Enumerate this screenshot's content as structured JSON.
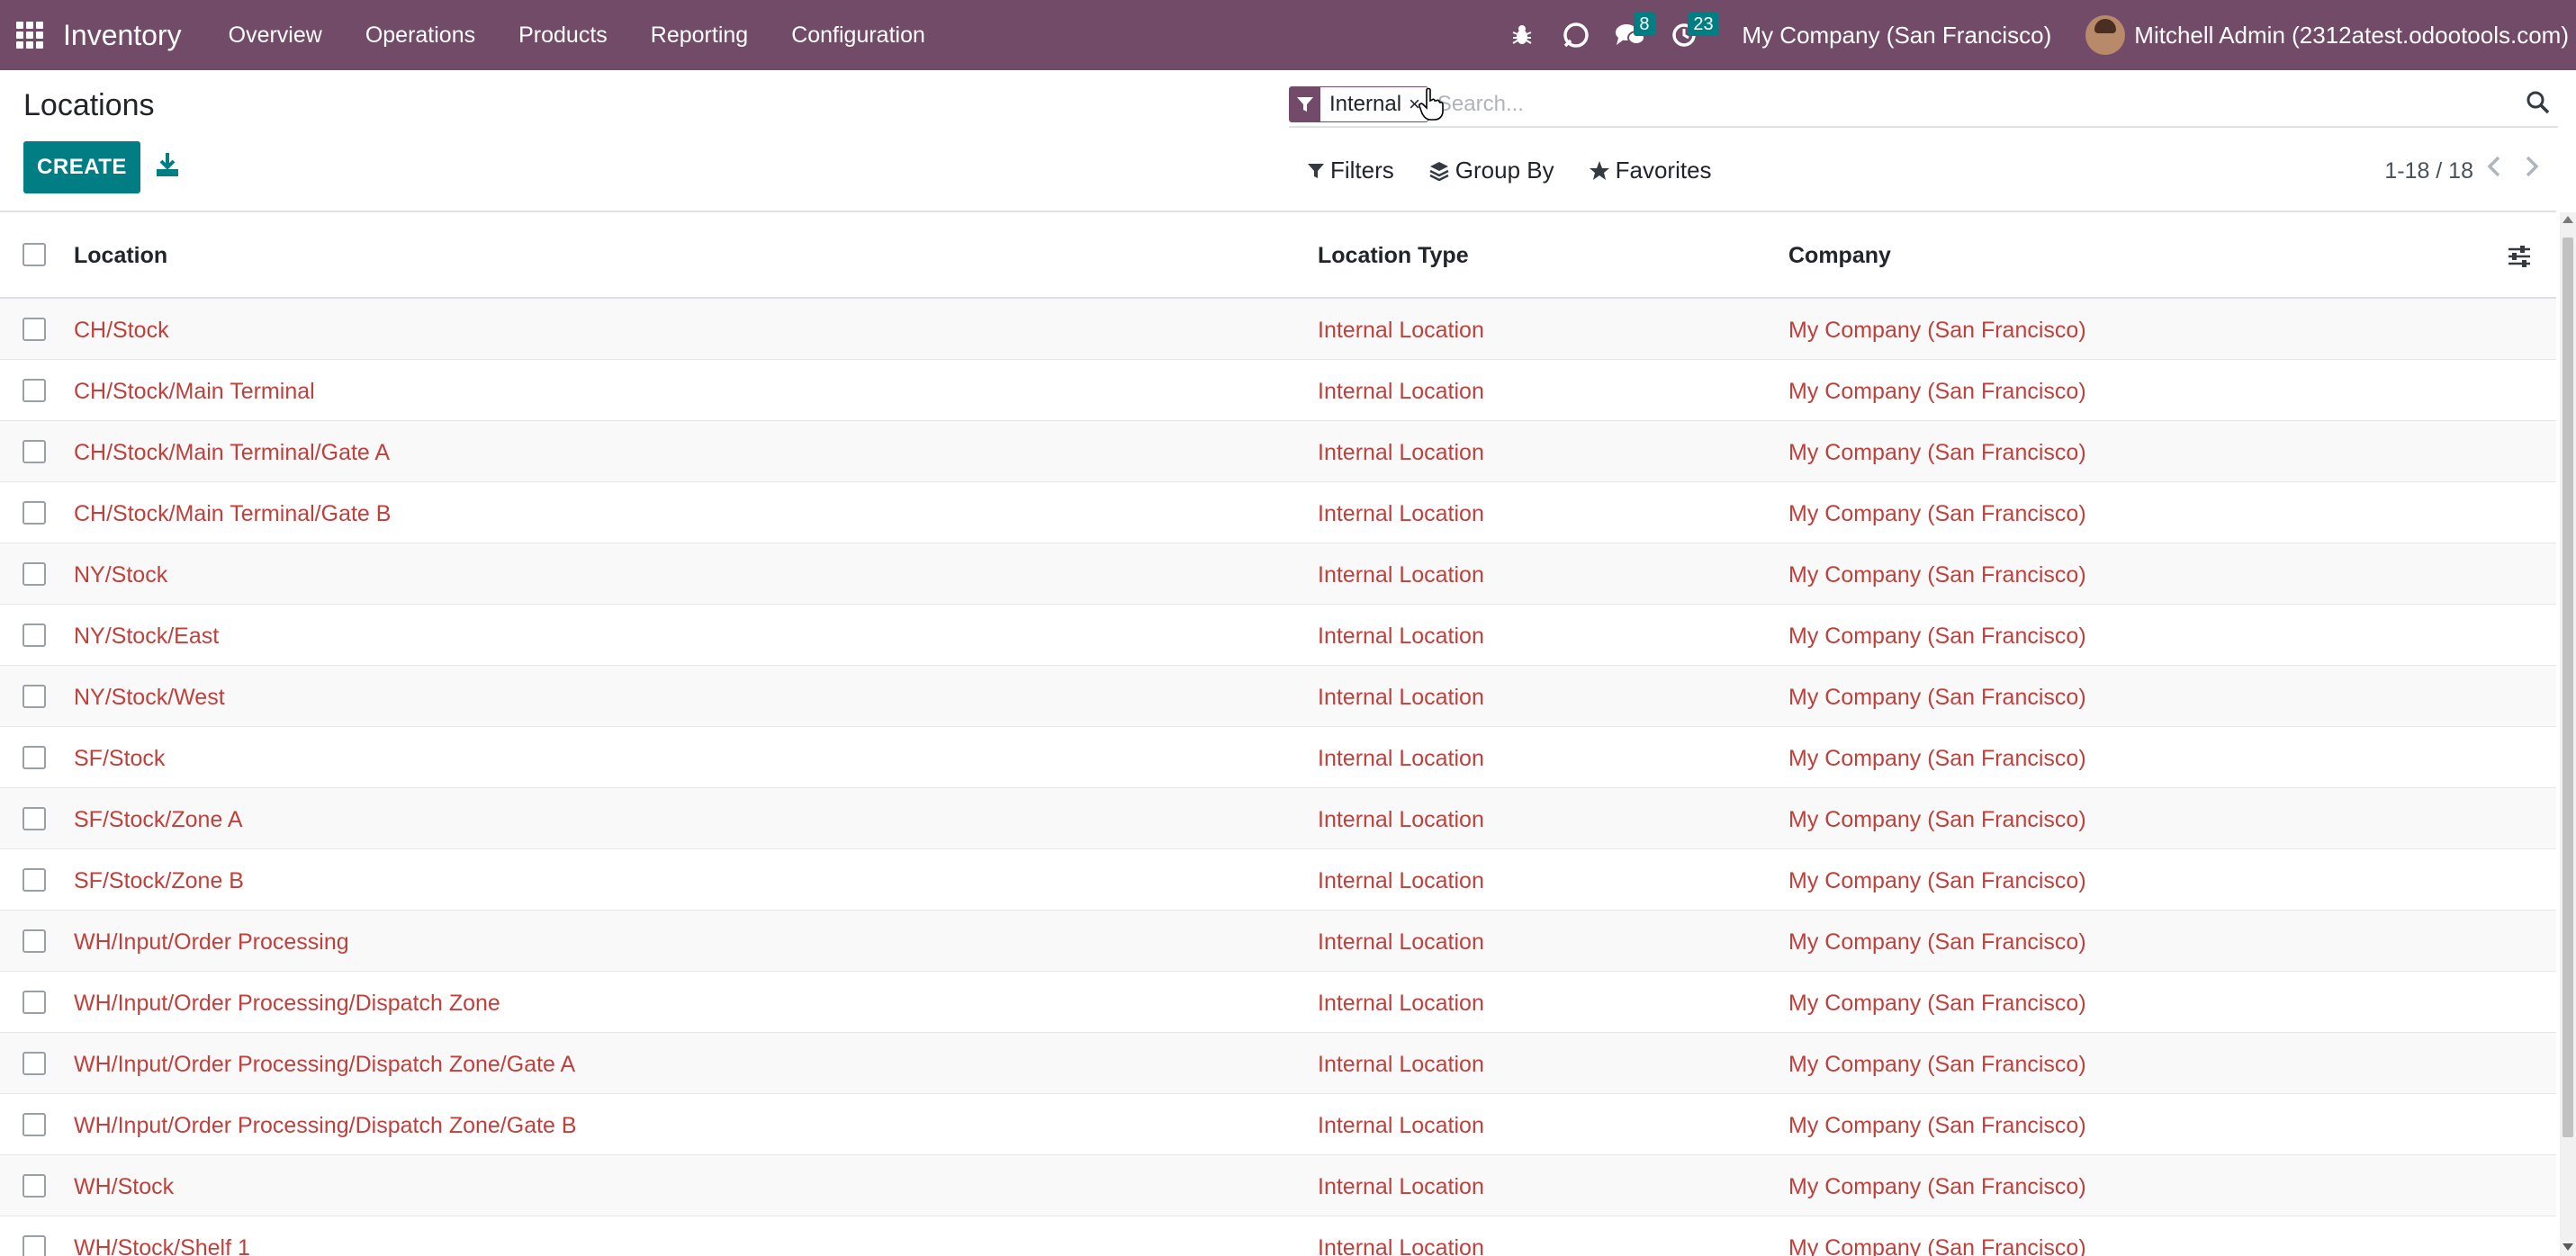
{
  "navbar": {
    "app_name": "Inventory",
    "menu": [
      "Overview",
      "Operations",
      "Products",
      "Reporting",
      "Configuration"
    ],
    "messages_count": "8",
    "activities_count": "23",
    "company": "My Company (San Francisco)",
    "user": "Mitchell Admin (2312atest.odootools.com)"
  },
  "control_panel": {
    "breadcrumb": "Locations",
    "create_label": "CREATE",
    "search": {
      "facet_value": "Internal",
      "facet_remove": "×",
      "placeholder": "Search..."
    },
    "filters_label": "Filters",
    "group_by_label": "Group By",
    "favorites_label": "Favorites",
    "pager": "1-18 / 18"
  },
  "table": {
    "headers": [
      "Location",
      "Location Type",
      "Company"
    ],
    "rows": [
      [
        "CH/Stock",
        "Internal Location",
        "My Company (San Francisco)"
      ],
      [
        "CH/Stock/Main Terminal",
        "Internal Location",
        "My Company (San Francisco)"
      ],
      [
        "CH/Stock/Main Terminal/Gate A",
        "Internal Location",
        "My Company (San Francisco)"
      ],
      [
        "CH/Stock/Main Terminal/Gate B",
        "Internal Location",
        "My Company (San Francisco)"
      ],
      [
        "NY/Stock",
        "Internal Location",
        "My Company (San Francisco)"
      ],
      [
        "NY/Stock/East",
        "Internal Location",
        "My Company (San Francisco)"
      ],
      [
        "NY/Stock/West",
        "Internal Location",
        "My Company (San Francisco)"
      ],
      [
        "SF/Stock",
        "Internal Location",
        "My Company (San Francisco)"
      ],
      [
        "SF/Stock/Zone A",
        "Internal Location",
        "My Company (San Francisco)"
      ],
      [
        "SF/Stock/Zone B",
        "Internal Location",
        "My Company (San Francisco)"
      ],
      [
        "WH/Input/Order Processing",
        "Internal Location",
        "My Company (San Francisco)"
      ],
      [
        "WH/Input/Order Processing/Dispatch Zone",
        "Internal Location",
        "My Company (San Francisco)"
      ],
      [
        "WH/Input/Order Processing/Dispatch Zone/Gate A",
        "Internal Location",
        "My Company (San Francisco)"
      ],
      [
        "WH/Input/Order Processing/Dispatch Zone/Gate B",
        "Internal Location",
        "My Company (San Francisco)"
      ],
      [
        "WH/Stock",
        "Internal Location",
        "My Company (San Francisco)"
      ],
      [
        "WH/Stock/Shelf 1",
        "Internal Location",
        "My Company (San Francisco)"
      ]
    ]
  },
  "colors": {
    "brand": "#714b67",
    "primary_button": "#017e84",
    "link": "#c0403c",
    "badge": "#017e84"
  },
  "icons": [
    "apps-grid-icon",
    "bug-icon",
    "odoobot-chat-icon",
    "messages-icon",
    "activity-clock-icon",
    "filter-icon",
    "search-icon",
    "download-icon",
    "layers-icon",
    "star-icon",
    "chevron-left-icon",
    "chevron-right-icon",
    "optional-columns-icon"
  ]
}
